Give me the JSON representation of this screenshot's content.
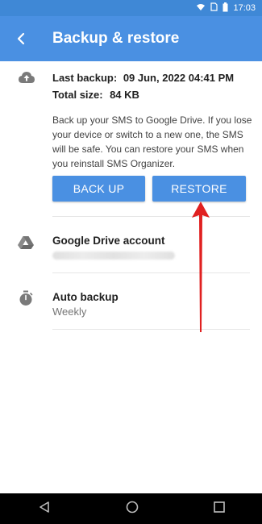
{
  "status_bar": {
    "time": "17:03"
  },
  "app_bar": {
    "title": "Backup & restore",
    "back_icon": "back-arrow-icon"
  },
  "backup": {
    "last_backup_label": "Last backup:",
    "last_backup_value": "09 Jun, 2022 04:41 PM",
    "total_size_label": "Total size:",
    "total_size_value": "84 KB",
    "description": "Back up your SMS to Google Drive. If you lose your device or switch to a new one, the SMS will be safe. You can restore your SMS when you reinstall SMS Organizer.",
    "back_up_button": "BACK UP",
    "restore_button": "RESTORE"
  },
  "drive": {
    "title": "Google Drive account",
    "icon": "google-drive-icon"
  },
  "auto_backup": {
    "title": "Auto backup",
    "value": "Weekly",
    "icon": "timer-icon"
  },
  "colors": {
    "accent": "#4a90e2",
    "status_bar": "#3f88d6",
    "arrow": "#e02020"
  }
}
